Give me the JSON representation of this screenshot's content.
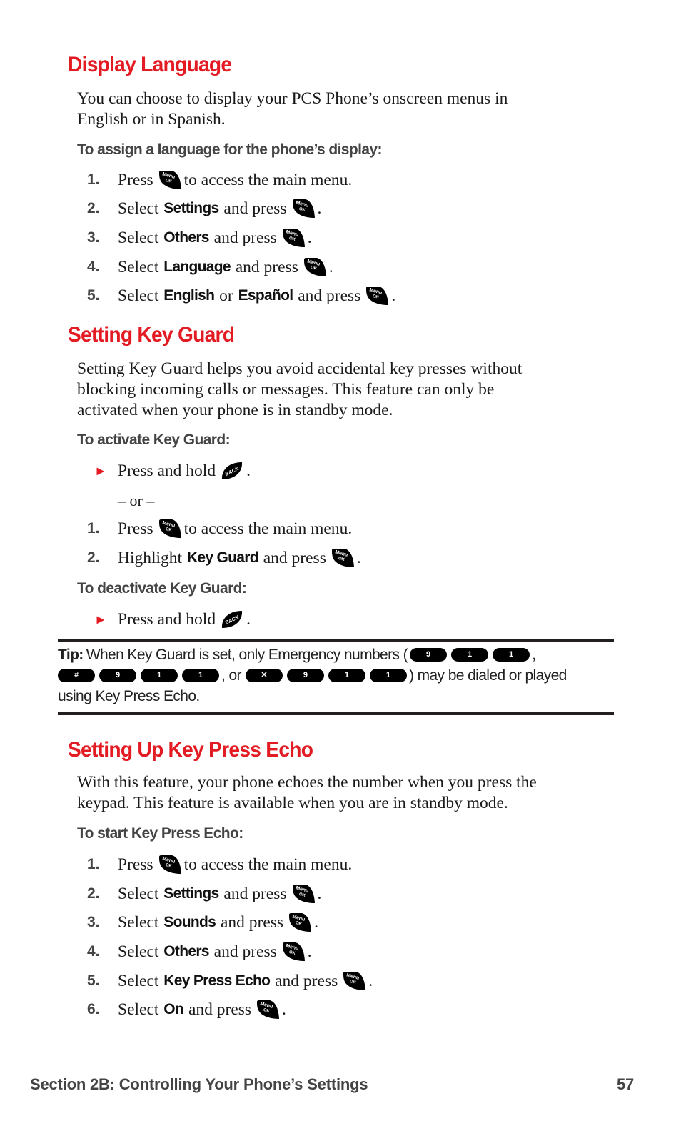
{
  "sections": {
    "display_language": {
      "title": "Display Language",
      "intro_line1": "You can choose to display your PCS Phone’s onscreen menus in",
      "intro_line2": "English or in Spanish.",
      "subheading": "To assign a language for the phone’s display:",
      "steps": [
        {
          "num": "1.",
          "pre": "Press",
          "bold": "",
          "mid": "",
          "bold2": "",
          "post": "to access the main menu.",
          "key": "menu-ok"
        },
        {
          "num": "2.",
          "pre": "Select",
          "bold": "Settings",
          "post": "and press",
          "key": "menu-ok"
        },
        {
          "num": "3.",
          "pre": "Select",
          "bold": "Others",
          "post": "and press",
          "key": "menu-ok"
        },
        {
          "num": "4.",
          "pre": "Select",
          "bold": "Language",
          "post": "and press",
          "key": "menu-ok"
        },
        {
          "num": "5.",
          "pre": "Select",
          "bold": "English",
          "mid": "or",
          "bold2": "Español",
          "post": "and press",
          "key": "menu-ok"
        }
      ]
    },
    "key_guard": {
      "title": "Setting Key Guard",
      "intro_line1": "Setting Key Guard helps you avoid accidental key presses without",
      "intro_line2": "blocking incoming calls or messages. This feature can only be",
      "intro_line3": "activated when your phone is in standby mode.",
      "activate_heading": "To activate Key Guard:",
      "activate_bullet": "Press and hold",
      "or_text": "– or –",
      "steps": [
        {
          "num": "1.",
          "pre": "Press",
          "post": "to access the main menu.",
          "key": "menu-ok"
        },
        {
          "num": "2.",
          "pre": "Highlight",
          "bold": "Key Guard",
          "post": "and press",
          "key": "menu-ok"
        }
      ],
      "deactivate_heading": "To deactivate Key Guard:",
      "deactivate_bullet": "Press and hold"
    },
    "tip": {
      "label": "Tip:",
      "line1": "When Key Guard is set, only Emergency numbers (",
      "keys_a": [
        "9",
        "1",
        "1"
      ],
      "sep1": ",",
      "keys_b": [
        "#",
        "9",
        "1",
        "1"
      ],
      "sep2": ", or",
      "keys_c": [
        "✕",
        "9",
        "1",
        "1"
      ],
      "line2_end": ") may be dialed or played",
      "line3": "using Key Press Echo."
    },
    "key_press_echo": {
      "title": "Setting Up Key Press Echo",
      "intro_line1": "With this feature, your phone echoes the number when you press the",
      "intro_line2": "keypad. This feature is available when you are in standby mode.",
      "subheading": "To start Key Press Echo:",
      "steps": [
        {
          "num": "1.",
          "pre": "Press",
          "post": "to access the main menu.",
          "key": "menu-ok"
        },
        {
          "num": "2.",
          "pre": "Select",
          "bold": "Settings",
          "post": "and press",
          "key": "menu-ok"
        },
        {
          "num": "3.",
          "pre": "Select",
          "bold": "Sounds",
          "post": "and press",
          "key": "menu-ok"
        },
        {
          "num": "4.",
          "pre": "Select",
          "bold": "Others",
          "post": "and press",
          "key": "menu-ok"
        },
        {
          "num": "5.",
          "pre": "Select",
          "bold": "Key Press Echo",
          "post": "and press",
          "key": "menu-ok"
        },
        {
          "num": "6.",
          "pre": "Select",
          "bold": "On",
          "post": "and press",
          "key": "menu-ok"
        }
      ]
    }
  },
  "keys": {
    "menu_ok_top": "Menu",
    "menu_ok_bottom": "OK",
    "back": "BACK"
  },
  "footer": {
    "section": "Section 2B: Controlling Your Phone’s Settings",
    "page_number": "57"
  },
  "colors": {
    "heading": "#e31b23",
    "subheading": "#444444",
    "bullet": "#e31b23"
  }
}
